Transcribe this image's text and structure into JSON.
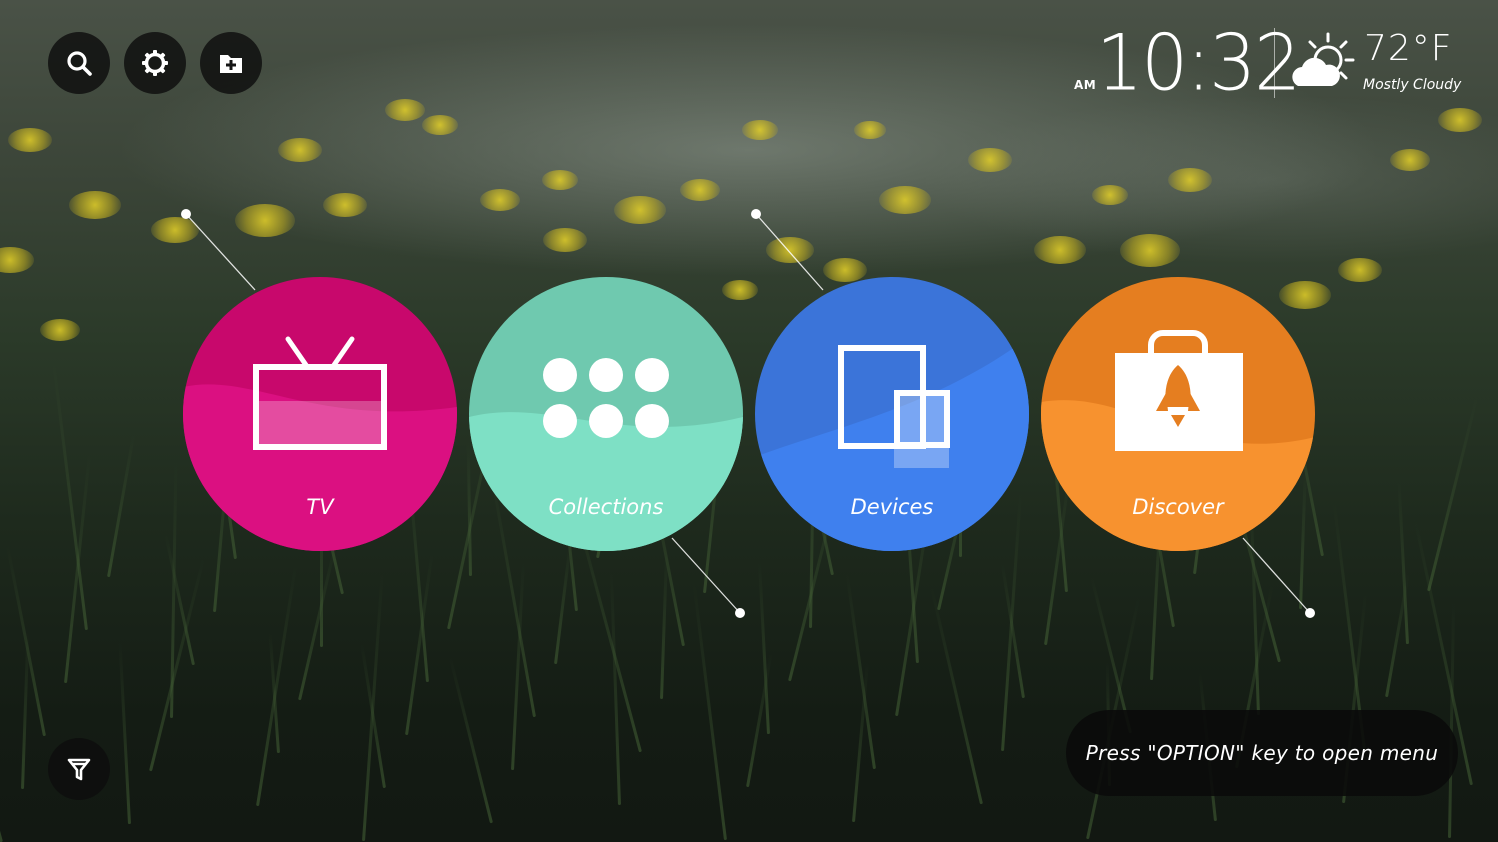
{
  "toolbar": {
    "search_icon": "search-icon",
    "settings_icon": "gear-icon",
    "add_icon": "folder-plus-icon"
  },
  "clock": {
    "ampm": "AM",
    "time": "10:32"
  },
  "weather": {
    "icon": "partly-cloudy-icon",
    "temperature": "72°F",
    "condition": "Mostly Cloudy"
  },
  "hubs": [
    {
      "label": "TV",
      "icon": "tv-icon",
      "color": "#E0147F"
    },
    {
      "label": "Collections",
      "icon": "apps-grid-icon",
      "color": "#7DDCC0"
    },
    {
      "label": "Devices",
      "icon": "devices-icon",
      "color": "#3D7CE6"
    },
    {
      "label": "Discover",
      "icon": "store-rocket-icon",
      "color": "#F3862A"
    }
  ],
  "filter_icon": "filter-icon",
  "hint": {
    "text": "Press \"OPTION\" key to open menu"
  }
}
